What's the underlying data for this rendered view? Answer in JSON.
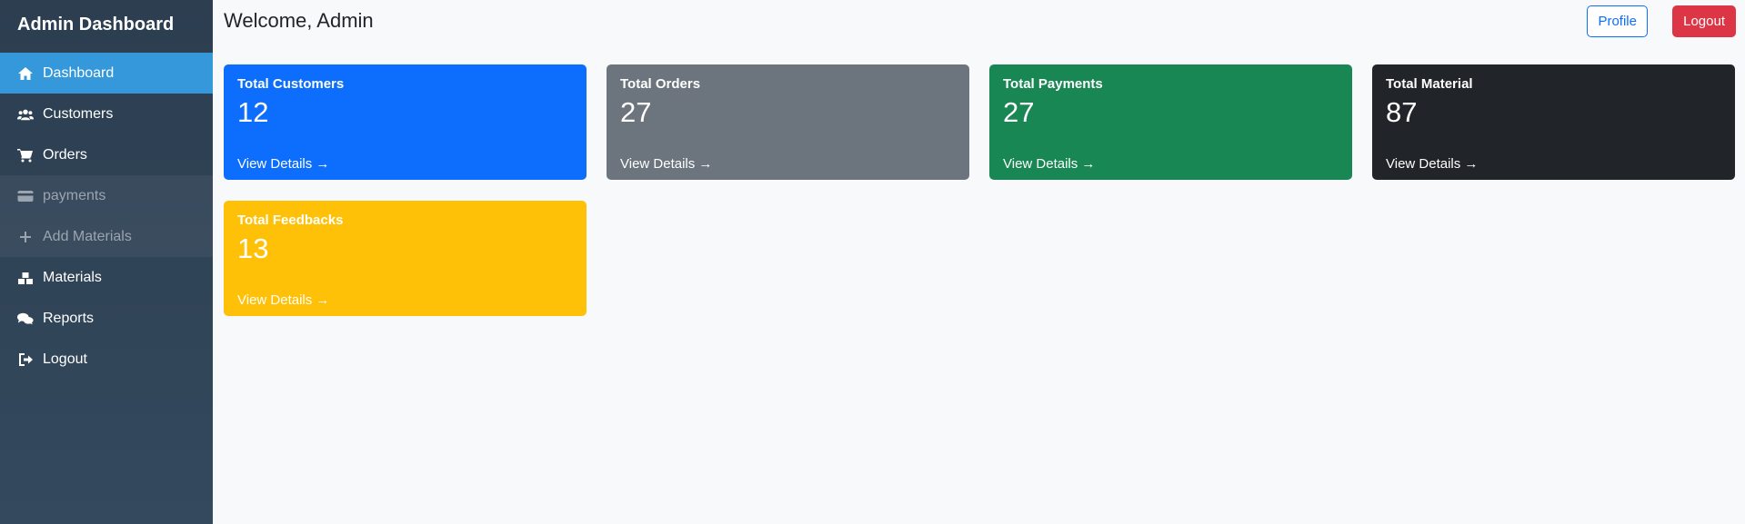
{
  "sidebar": {
    "brand": "Admin Dashboard",
    "items": [
      {
        "label": "Dashboard",
        "icon": "home-icon"
      },
      {
        "label": "Customers",
        "icon": "users-icon"
      },
      {
        "label": "Orders",
        "icon": "cart-icon"
      },
      {
        "label": "payments",
        "icon": "credit-card-icon"
      },
      {
        "label": "Add Materials",
        "icon": "plus-icon"
      },
      {
        "label": "Materials",
        "icon": "boxes-icon"
      },
      {
        "label": "Reports",
        "icon": "comments-icon"
      },
      {
        "label": "Logout",
        "icon": "sign-out-icon"
      }
    ]
  },
  "header": {
    "welcome": "Welcome, Admin",
    "profile_label": "Profile",
    "logout_label": "Logout"
  },
  "cards": [
    {
      "title": "Total Customers",
      "value": "12",
      "link": "View Details →",
      "color": "#0d6efd"
    },
    {
      "title": "Total Orders",
      "value": "27",
      "link": "View Details →",
      "color": "#6c757d"
    },
    {
      "title": "Total Payments",
      "value": "27",
      "link": "View Details →",
      "color": "#198754"
    },
    {
      "title": "Total Material",
      "value": "87",
      "link": "View Details →",
      "color": "#212529"
    },
    {
      "title": "Total Feedbacks",
      "value": "13",
      "link": "View Details →",
      "color": "#ffc107"
    }
  ],
  "colors": {
    "sidebar_bg": "#2c3e50",
    "active_item": "#3498db",
    "profile_button": "#0d6efd",
    "logout_button": "#dc3545"
  }
}
